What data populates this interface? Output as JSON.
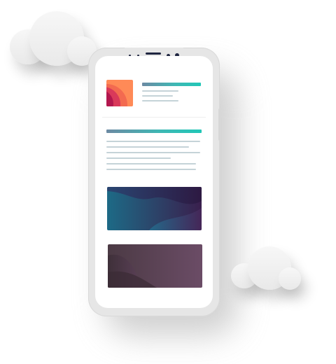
{
  "illustration": {
    "colors": {
      "cloud": "#f3f3f3",
      "phone_body": "#e6e6e6",
      "screen": "#ffffff",
      "accent_gradient_start": "#6c8aa3",
      "accent_gradient_end": "#21c7b7",
      "text_lines": "#c5d3d8",
      "card_top_gradient": [
        "#1d6a86",
        "#3a1f4d"
      ],
      "card_bottom_gradient": [
        "#4b3a44",
        "#6b4c66"
      ],
      "thumb_gradient": [
        "#b3174e",
        "#ffa05a"
      ]
    },
    "icons": [
      "cloud-icon",
      "phone-icon",
      "camera-icon",
      "speaker-icon"
    ]
  }
}
